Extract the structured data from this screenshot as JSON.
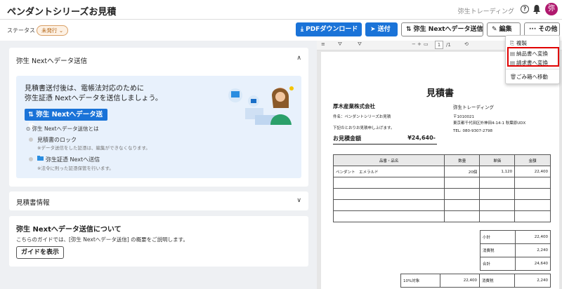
{
  "header": {
    "title": "ペンダントシリーズお見積",
    "company": "弥生トレーディング",
    "avatar_text": "弥"
  },
  "status": {
    "label": "ステータス",
    "badge": "未発行 ⌄"
  },
  "toolbar": {
    "pdf_download": "⤓ PDFダウンロード",
    "send": "➤ 送付",
    "yayoi_send": "⇅ 弥生 Nextへデータ送信",
    "edit": "✎ 編集",
    "more": "··· その他"
  },
  "left": {
    "send_card_title": "弥生 Nextへデータ送信",
    "intro_line1": "見積書送付後は、電帳法対応のために",
    "intro_line2": "弥生証憑 Nextへデータを送信しましょう。",
    "send_button": "⇅ 弥生 Nextへデータ送信",
    "what_is": "⊙ 弥生 Nextへデータ送信とは",
    "feature1_title": "見積書のロック",
    "feature1_desc": "※データ送信をした証憑は、編集ができなくなります。",
    "feature2_title": "弥生証憑 Nextへ送信",
    "feature2_desc": "※法令に則った証憑保管を行います。",
    "info_card_title": "見積書情報",
    "guide_title": "弥生 Nextへデータ送信について",
    "guide_text": "こちらのガイドでは、[弥生 Nextへデータ送信] の概要をご説明します。",
    "guide_button": "ガイドを表示"
  },
  "pdf": {
    "page_current": "1",
    "page_total": "/1",
    "doc_title": "見積書",
    "customer": "厚木産業株式会社",
    "subject": "件名：ペンダントシリーズお見積",
    "greeting": "下記のとおりお見積申し上げます。",
    "amount_label": "お見積金額",
    "amount_value": "¥24,640-",
    "issuer_name": "弥生トレーディング",
    "issuer_zip": "〒1010021",
    "issuer_address": "東京都千代田区外神田4-14-1 秋葉原UDX",
    "issuer_tel": "TEL: 080-9307-2798",
    "columns": [
      "品番・品名",
      "数量",
      "単価",
      "金額"
    ],
    "rows": [
      [
        "ペンダント　エメラルド",
        "20個",
        "1,120",
        "22,400"
      ],
      [
        "",
        "",
        "",
        ""
      ],
      [
        "",
        "",
        "",
        ""
      ],
      [
        "",
        "",
        "",
        ""
      ],
      [
        "",
        "",
        "",
        ""
      ]
    ],
    "subtotal_label": "小計",
    "subtotal_value": "22,400",
    "tax_label": "消費税",
    "tax_value": "2,240",
    "total_label": "合計",
    "total_value": "24,640",
    "rate_label": "10%対象",
    "rate_base": "22,400",
    "rate_tax_label": "消費税",
    "rate_tax": "2,240"
  },
  "menu": {
    "copy": "複製",
    "to_delivery": "納品書へ変換",
    "to_invoice": "請求書へ変換",
    "trash": "ごみ箱へ移動"
  },
  "colors": {
    "primary": "#1a73d8",
    "highlight": "#e00000",
    "avatar": "#b0186e"
  }
}
